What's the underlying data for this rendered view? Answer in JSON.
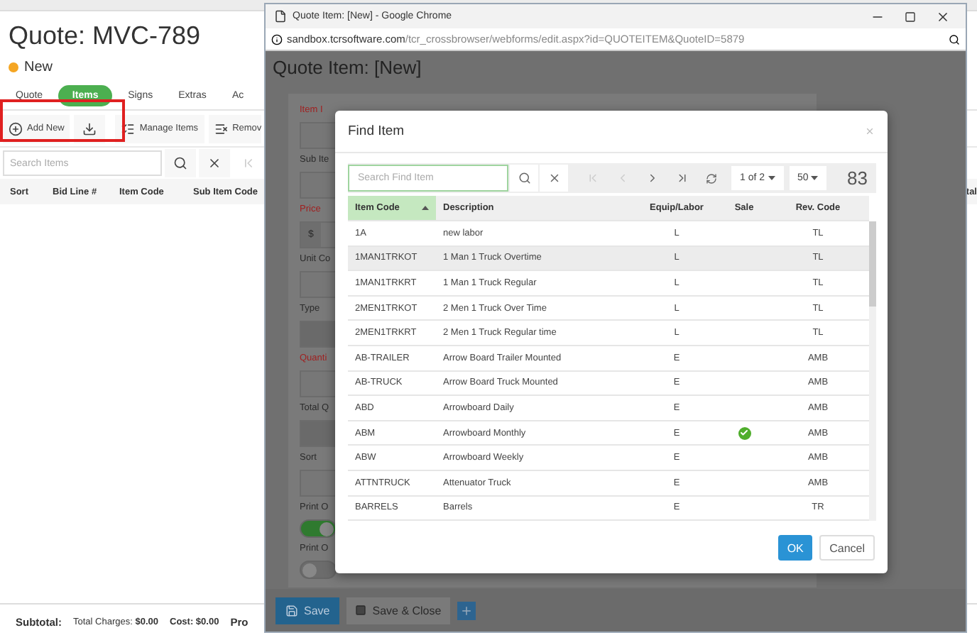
{
  "page": {
    "title": "Quote: MVC-789",
    "status": {
      "label": "New",
      "color": "#f5a623"
    },
    "tabs": [
      {
        "label": "Quote",
        "selected": false
      },
      {
        "label": "Items",
        "selected": true
      },
      {
        "label": "Signs",
        "selected": false
      },
      {
        "label": "Extras",
        "selected": false
      },
      {
        "label": "Ac",
        "selected": false
      }
    ],
    "toolbar": {
      "add": "Add New",
      "manage": "Manage Items",
      "remove": "Remov"
    },
    "search": {
      "placeholder": "Search Items"
    },
    "columns": [
      "Sort",
      "Bid Line #",
      "Item Code",
      "Sub Item Code"
    ],
    "column_edge": "tal",
    "footer": {
      "subtotal": "Subtotal:",
      "totals": [
        "Total Charges: **$0.00**",
        "**Cost: $0.00**"
      ],
      "edge": "Pro"
    }
  },
  "browser": {
    "title": "Quote Item: [New] - Google Chrome",
    "url_host": "sandbox.tcrsoftware.com",
    "url_path": "/tcr_crossbrowser/webforms/edit.aspx?id=QUOTEITEM&QuoteID=5879"
  },
  "form": {
    "heading": "Quote Item: [New]",
    "fields": [
      {
        "label": "Item I",
        "required": true,
        "kind": "input"
      },
      {
        "label": "Sub Ite",
        "required": false,
        "kind": "input"
      },
      {
        "label": "Price",
        "required": true,
        "kind": "price",
        "prefix": "$"
      },
      {
        "label": "Unit Co",
        "required": false,
        "kind": "input"
      },
      {
        "label": "Type",
        "required": false,
        "kind": "select"
      },
      {
        "label": "Quanti",
        "required": true,
        "kind": "input"
      },
      {
        "label": "Total Q",
        "required": false,
        "kind": "select"
      },
      {
        "label": "Sort",
        "required": false,
        "kind": "input"
      },
      {
        "label": "Print O",
        "required": false,
        "kind": "toggle",
        "on": true
      },
      {
        "label": "Print O",
        "required": false,
        "kind": "toggle",
        "on": false
      }
    ],
    "buttons": {
      "save": "Save",
      "save_close": "Save & Close"
    }
  },
  "dialog": {
    "title": "Find Item",
    "search_placeholder": "Search Find Item",
    "page": "1 of 2",
    "page_size": "50",
    "count": "83",
    "columns": [
      {
        "label": "Item Code",
        "sorted": true
      },
      {
        "label": "Description",
        "sorted": false
      },
      {
        "label": "Equip/Labor",
        "sorted": false
      },
      {
        "label": "Sale",
        "sorted": false
      },
      {
        "label": "Rev. Code",
        "sorted": false
      }
    ],
    "rows": [
      {
        "code": "1A",
        "description": "new labor",
        "type": "L",
        "sale": false,
        "rev": "TL",
        "selected": false
      },
      {
        "code": "1MAN1TRKOT",
        "description": "1 Man 1 Truck Overtime",
        "type": "L",
        "sale": false,
        "rev": "TL",
        "selected": true
      },
      {
        "code": "1MAN1TRKRT",
        "description": "1 Man 1 Truck Regular",
        "type": "L",
        "sale": false,
        "rev": "TL",
        "selected": false
      },
      {
        "code": "2MEN1TRKOT",
        "description": "2 Men 1 Truck Over Time",
        "type": "L",
        "sale": false,
        "rev": "TL",
        "selected": false
      },
      {
        "code": "2MEN1TRKRT",
        "description": "2 Men 1 Truck Regular time",
        "type": "L",
        "sale": false,
        "rev": "TL",
        "selected": false
      },
      {
        "code": "AB-TRAILER",
        "description": "Arrow Board Trailer Mounted",
        "type": "E",
        "sale": false,
        "rev": "AMB",
        "selected": false
      },
      {
        "code": "AB-TRUCK",
        "description": "Arrow Board Truck Mounted",
        "type": "E",
        "sale": false,
        "rev": "AMB",
        "selected": false
      },
      {
        "code": "ABD",
        "description": "Arrowboard Daily",
        "type": "E",
        "sale": false,
        "rev": "AMB",
        "selected": false
      },
      {
        "code": "ABM",
        "description": "Arrowboard Monthly",
        "type": "E",
        "sale": true,
        "rev": "AMB",
        "selected": false
      },
      {
        "code": "ABW",
        "description": "Arrowboard Weekly",
        "type": "E",
        "sale": false,
        "rev": "AMB",
        "selected": false
      },
      {
        "code": "ATTNTRUCK",
        "description": "Attenuator Truck",
        "type": "E",
        "sale": false,
        "rev": "AMB",
        "selected": false
      },
      {
        "code": "BARRELS",
        "description": "Barrels",
        "type": "E",
        "sale": false,
        "rev": "TR",
        "selected": false
      }
    ],
    "buttons": {
      "ok": "OK",
      "cancel": "Cancel"
    }
  }
}
